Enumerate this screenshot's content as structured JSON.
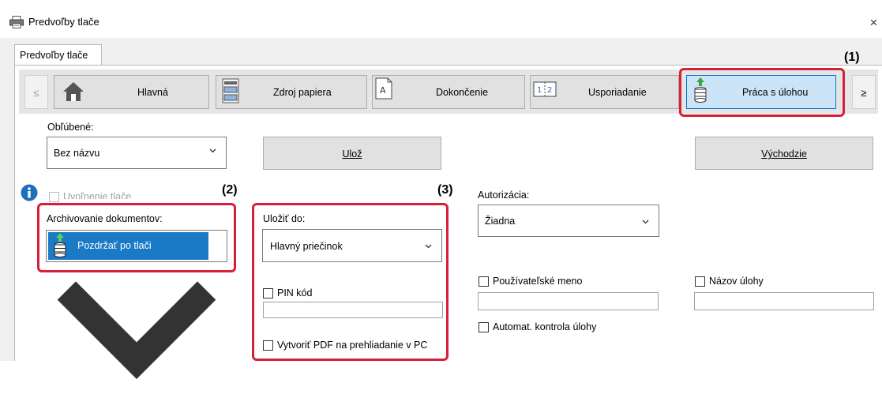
{
  "window": {
    "title": "Predvoľby tlače",
    "close_symbol": "×"
  },
  "tabs": [
    {
      "label": "Predvoľby tlače",
      "selected": true
    }
  ],
  "nav": {
    "prev_symbol": "≤",
    "next_symbol": "≥",
    "buttons": [
      {
        "label": "Hlavná",
        "icon": "home-icon"
      },
      {
        "label": "Zdroj papiera",
        "icon": "paper-tray-icon"
      },
      {
        "label": "Dokončenie",
        "icon": "finishing-icon"
      },
      {
        "label": "Usporiadanie",
        "icon": "layout-icon"
      },
      {
        "label": "Práca s úlohou",
        "icon": "job-handling-icon",
        "selected": true
      }
    ]
  },
  "callouts": [
    "(1)",
    "(2)",
    "(3)"
  ],
  "favorites": {
    "label": "Obľúbené:",
    "value": "Bez názvu",
    "save_label": "Ulož",
    "default_label": "Východzie"
  },
  "release": {
    "label": "Uvoľnenie tlače",
    "info_symbol": "i"
  },
  "archiving": {
    "label": "Archivovanie dokumentov:",
    "value": "Pozdržať po tlači"
  },
  "save_to": {
    "label": "Uložiť do:",
    "value": "Hlavný priečinok"
  },
  "pin": {
    "label": "PIN kód",
    "value": ""
  },
  "pdf": {
    "label": "Vytvoriť PDF na prehliadanie v PC"
  },
  "authorization": {
    "label": "Autorizácia:",
    "value": "Žiadna"
  },
  "username": {
    "label": "Používateľské meno",
    "value": ""
  },
  "jobname": {
    "label": "Názov úlohy",
    "value": ""
  },
  "autocheck": {
    "label": "Automat. kontrola úlohy"
  },
  "colors": {
    "highlight": "#d6203a",
    "selected_button": "#cce4f7",
    "selected_border": "#0078d7",
    "archive_select_bg": "#1a7ac6",
    "info_icon": "#1f6fbf"
  }
}
